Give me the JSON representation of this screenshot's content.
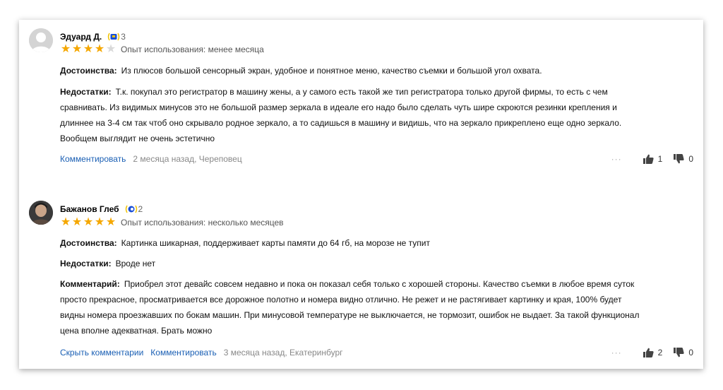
{
  "reviews": [
    {
      "author": "Эдуард Д.",
      "badge_count": "3",
      "rating": 4,
      "experience": "Опыт использования: менее месяца",
      "pros_label": "Достоинства:",
      "pros": "Из плюсов большой сенсорный экран, удобное и понятное меню, качество съемки и большой угол охвата.",
      "cons_label": "Недостатки:",
      "cons_lines": [
        "Т.к. покупал это регистратор в машину жены, а у самого есть такой же тип регистратора только другой фирмы, то есть с чем",
        "сравнивать. Из видимых минусов это не большой размер зеркала в идеале его надо было сделать чуть шире скроются резинки крепления и",
        "длиннее на 3-4 см так чтоб оно скрывало родное зеркало, а то садишься в машину и видишь, что на зеркало прикреплено еще одно зеркало.",
        "Вообщем выглядит не очень эстетично"
      ],
      "comment_link": "Комментировать",
      "meta": "2 месяца назад, Череповец",
      "more": "···",
      "likes": "1",
      "dislikes": "0"
    },
    {
      "author": "Бажанов Глеб",
      "badge_count": "2",
      "rating": 5,
      "experience": "Опыт использования: несколько месяцев",
      "pros_label": "Достоинства:",
      "pros": "Картинка шикарная, поддерживает карты памяти до 64 гб, на морозе не тупит",
      "cons_label": "Недостатки:",
      "cons": "Вроде нет",
      "comment_label": "Комментарий:",
      "comment_lines": [
        "Приобрел этот девайс совсем недавно и пока он показал себя только с хорошей стороны. Качество съемки в любое время суток",
        "просто прекрасное, просматривается все дорожное полотно и номера видно отлично. Не режет и не растягивает картинку и края, 100% будет",
        "видны номера проезжавших по бокам машин. При минусовой температуре не выключается, не тормозит, ошибок не выдает. За такой функционал",
        "цена вполне адекватная. Брать можно"
      ],
      "hide_link": "Скрыть комментарии",
      "comment_link": "Комментировать",
      "meta": "3 месяца назад, Екатеринбург",
      "more": "···",
      "likes": "2",
      "dislikes": "0"
    }
  ],
  "colors": {
    "star_on": "#f5a700",
    "star_off": "#d9d9d9",
    "link": "#1a5fb4",
    "badge_blue": "#1a4fd6",
    "badge_yellow": "#f0c200"
  },
  "icons": {
    "star": "star-icon",
    "badge": "laurel-badge-icon",
    "like": "thumbs-up-icon",
    "dislike": "thumbs-down-icon",
    "more": "more-dots-icon"
  }
}
